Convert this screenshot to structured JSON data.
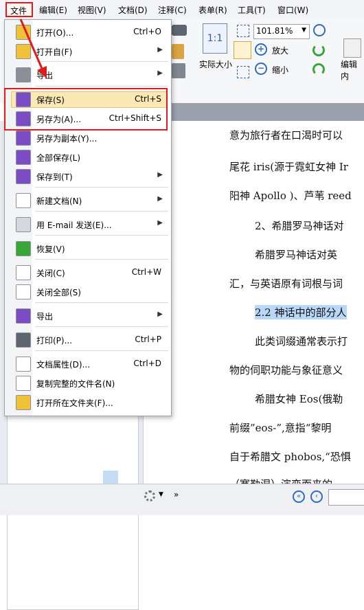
{
  "menubar": {
    "items": [
      "文件",
      "编辑(E)",
      "视图(V)",
      "文档(D)",
      "注释(C)",
      "表单(R)",
      "工具(T)",
      "窗口(W)"
    ]
  },
  "ribbon": {
    "zoom_value": "101.81%",
    "actual_size": "实际大小",
    "zoom_in": "放大",
    "zoom_out": "缩小",
    "edit_content": "编辑内",
    "one_to_one": "1:1"
  },
  "file_menu": {
    "items": [
      {
        "label": "打开(O)...",
        "shortcut": "Ctrl+O",
        "icon": "folder-open-icon"
      },
      {
        "label": "打开自(F)",
        "shortcut": "",
        "submenu": true,
        "icon": "folder-open-from-icon"
      },
      {
        "label": "导出",
        "shortcut": "",
        "submenu": true,
        "icon": "open-export-icon"
      },
      {
        "label": "保存(S)",
        "shortcut": "Ctrl+S",
        "icon": "save-icon"
      },
      {
        "label": "另存为(A)...",
        "shortcut": "Ctrl+Shift+S",
        "icon": "save-as-icon"
      },
      {
        "label": "另存为副本(Y)...",
        "shortcut": "",
        "icon": "save-copy-icon"
      },
      {
        "label": "全部保存(L)",
        "shortcut": "",
        "icon": "save-all-icon"
      },
      {
        "label": "保存到(T)",
        "shortcut": "",
        "submenu": true,
        "icon": "save-to-icon"
      },
      {
        "label": "新建文档(N)",
        "shortcut": "",
        "submenu": true,
        "icon": "new-document-icon"
      },
      {
        "label": "用 E-mail 发送(E)...",
        "shortcut": "",
        "submenu": true,
        "icon": "email-icon"
      },
      {
        "label": "恢复(V)",
        "shortcut": "",
        "icon": "revert-icon"
      },
      {
        "label": "关闭(C)",
        "shortcut": "Ctrl+W",
        "icon": "close-document-icon"
      },
      {
        "label": "关闭全部(S)",
        "shortcut": "",
        "icon": "close-all-icon"
      },
      {
        "label": "导出",
        "shortcut": "",
        "submenu": true,
        "icon": "export-icon"
      },
      {
        "label": "打印(P)...",
        "shortcut": "Ctrl+P",
        "icon": "printer-icon"
      },
      {
        "label": "文档属性(D)...",
        "shortcut": "Ctrl+D",
        "icon": "properties-icon"
      },
      {
        "label": "复制完整的文件名(N)",
        "shortcut": "",
        "icon": "copy-filename-icon"
      },
      {
        "label": "打开所在文件夹(F)...",
        "shortcut": "",
        "icon": "open-folder-icon"
      }
    ]
  },
  "document": {
    "lines": [
      "意为旅行者在口渴时可以",
      "尾花 iris(源于霓虹女神 Ir",
      "阳神 Apollo )、芦苇 reed",
      "2、希腊罗马神话对",
      "希腊罗马神话对英",
      "汇，与英语原有词根与词",
      "2.2 神话中的部分人",
      "此类词缀通常表示打",
      "物的伺职功能与象征意义",
      "希腊女神 Eos(俄勒",
      "前缀”eos-”,意指“黎明",
      "自于希腊文 phobos,“恐惧",
      "（塞勒涅）演变而来的"
    ]
  },
  "colors": {
    "highlight": "#fbe8b5",
    "red_annotation": "#e11b1b",
    "selected_text_bg": "#b9d8f7"
  }
}
